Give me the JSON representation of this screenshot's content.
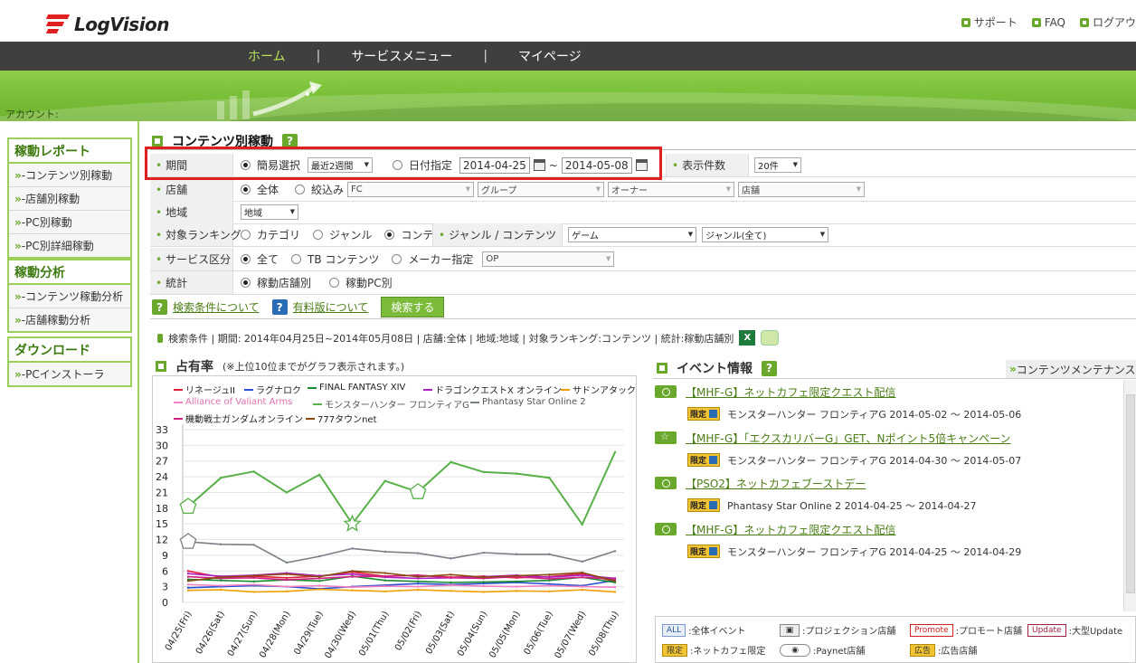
{
  "header": {
    "logo_text": "LogVision",
    "links": [
      {
        "label": "サポート",
        "icon": "home-icon"
      },
      {
        "label": "FAQ",
        "icon": "home-icon"
      },
      {
        "label": "ログアウ",
        "icon": "home-icon"
      }
    ]
  },
  "nav": {
    "items": [
      "ホーム",
      "サービスメニュー",
      "マイページ"
    ],
    "separator": "|",
    "active_index": 0
  },
  "account": {
    "label": "アカウント:"
  },
  "sidebar": {
    "groups": [
      {
        "title": "稼動レポート",
        "items": [
          "-コンテンツ別稼動",
          "-店舗別稼動",
          "-PC別稼動",
          "-PC別詳細稼動"
        ]
      },
      {
        "title": "稼動分析",
        "items": [
          "-コンテンツ稼動分析",
          "-店舗稼動分析"
        ]
      },
      {
        "title": "ダウンロード",
        "items": [
          "-PCインストーラ"
        ]
      }
    ],
    "bullet": "»"
  },
  "content": {
    "title": "コンテンツ別稼動",
    "help": "?"
  },
  "filters": {
    "period": {
      "label": "期間",
      "simple_label": "簡易選択",
      "simple_value": "最近2週間",
      "date_label": "日付指定",
      "date_from": "2014-04-25",
      "tilde": "~",
      "date_to": "2014-05-08",
      "display_count_label": "表示件数",
      "display_count_value": "20件"
    },
    "store": {
      "label": "店舗",
      "all_label": "全体",
      "narrow_label": "絞込み",
      "selects": [
        "FC",
        "グループ",
        "オーナー",
        "店舗"
      ]
    },
    "region": {
      "label": "地域",
      "value": "地域"
    },
    "ranking": {
      "label": "対象ランキング",
      "options": [
        "カテゴリ",
        "ジャンル",
        "コンテンツ"
      ],
      "genre_label": "ジャンル / コンテンツ",
      "genre_value": "ゲーム",
      "genre_all": "ジャンル(全て)"
    },
    "service": {
      "label": "サービス区分",
      "options": [
        "全て",
        "TB コンテンツ",
        "メーカー指定"
      ],
      "maker_value": "OP"
    },
    "stats": {
      "label": "統計",
      "options": [
        "稼動店舗別",
        "稼動PC別"
      ]
    }
  },
  "search": {
    "about_conditions": "検索条件について",
    "about_paid": "有料版について",
    "button": "検索する"
  },
  "condition_summary": "検索条件 | 期間: 2014年04月25日~2014年05月08日 | 店舗:全体 | 地域:地域 | 対象ランキング:コンテンツ | 統計:稼動店舗別",
  "share": {
    "title": "占有率",
    "note": "(※上位10位までがグラフ表示されます。)"
  },
  "chart_data": {
    "type": "line",
    "title": "占有率",
    "x": [
      "04/25(Fri)",
      "04/26(Sat)",
      "04/27(Sun)",
      "04/28(Mon)",
      "04/29(Tue)",
      "04/30(Wed)",
      "05/01(Thu)",
      "05/02(Fri)",
      "05/03(Sat)",
      "05/04(Sun)",
      "05/05(Mon)",
      "05/06(Tue)",
      "05/07(Wed)",
      "05/08(Thu)"
    ],
    "yticks": [
      0,
      3,
      6,
      9,
      12,
      15,
      18,
      21,
      24,
      27,
      30,
      33
    ],
    "ylim": [
      0,
      33
    ],
    "grid": true,
    "legend_placement": "top",
    "series": [
      {
        "name": "リネージュII",
        "color": "#e0203a",
        "values": [
          6.0,
          4.8,
          5.0,
          4.7,
          5.0,
          5.8,
          5.0,
          5.2,
          4.8,
          5.0,
          4.7,
          4.9,
          5.5,
          4.0
        ]
      },
      {
        "name": "ラグナロク",
        "color": "#2850d0",
        "values": [
          2.8,
          3.0,
          3.2,
          3.0,
          2.6,
          3.0,
          3.3,
          3.6,
          3.4,
          3.6,
          3.8,
          3.5,
          3.2,
          4.2
        ]
      },
      {
        "name": "FINAL FANTASY XIV",
        "color": "#1a8a30",
        "values": [
          4.4,
          4.2,
          4.0,
          4.3,
          4.1,
          5.0,
          4.2,
          4.0,
          3.8,
          3.9,
          4.0,
          4.2,
          4.8,
          3.8
        ]
      },
      {
        "name": "ドラゴンクエストX オンライン",
        "color": "#b020c0",
        "values": [
          5.5,
          5.0,
          5.2,
          5.6,
          5.1,
          5.4,
          4.8,
          4.6,
          4.7,
          4.9,
          5.2,
          4.8,
          5.2,
          4.6
        ]
      },
      {
        "name": "サドンアタック",
        "color": "#f0a000",
        "values": [
          2.3,
          2.4,
          2.0,
          2.1,
          2.5,
          2.3,
          2.1,
          2.4,
          2.2,
          2.0,
          2.2,
          2.1,
          2.4,
          2.0
        ]
      },
      {
        "name": "Alliance of Valiant Arms",
        "color": "#f080c0",
        "values": [
          3.4,
          3.2,
          3.4,
          3.0,
          3.2,
          2.9,
          3.1,
          3.0,
          3.3,
          3.1,
          3.0,
          3.2,
          3.0,
          2.9
        ]
      },
      {
        "name": "モンスターハンター フロンティアG",
        "color": "#58b048",
        "values": [
          18.3,
          23.8,
          25.0,
          21.0,
          24.4,
          15.0,
          23.2,
          21.1,
          26.8,
          24.9,
          24.6,
          23.8,
          14.9,
          28.7
        ]
      },
      {
        "name": "Phantasy Star Online 2",
        "color": "#7a8088",
        "values": [
          11.6,
          11.1,
          11.0,
          7.6,
          8.8,
          10.3,
          9.7,
          9.4,
          8.4,
          9.5,
          9.2,
          9.2,
          7.8,
          9.8
        ]
      },
      {
        "name": "機動戦士ガンダムオンライン",
        "color": "#d02080",
        "values": [
          4.9,
          4.6,
          4.7,
          4.3,
          4.6,
          4.9,
          5.0,
          5.2,
          4.7,
          4.6,
          4.9,
          4.5,
          4.8,
          4.4
        ]
      },
      {
        "name": "777タウンnet",
        "color": "#8a4a10",
        "values": [
          4.1,
          4.8,
          5.1,
          5.4,
          4.9,
          6.0,
          5.6,
          4.9,
          5.3,
          4.8,
          5.1,
          5.3,
          5.7,
          4.1
        ]
      }
    ]
  },
  "events": {
    "title": "イベント情報",
    "maintenance_link": "コンテンツメンテナンス一覧",
    "items": [
      {
        "title": "【MHF-G】ネットカフェ限定クエスト配信",
        "tag": "限定",
        "desc": "モンスターハンター フロンティアG  2014-05-02 ～ 2014-05-06",
        "badge": "circle-icon"
      },
      {
        "title": "【MHF-G】「エクスカリバーG」GET、Nポイント5倍キャンペーン",
        "tag": "限定",
        "desc": "モンスターハンター フロンティアG  2014-04-30 ～ 2014-05-07",
        "badge": "star-icon"
      },
      {
        "title": "【PSO2】ネットカフェブーストデー",
        "tag": "限定",
        "desc": "Phantasy Star Online 2  2014-04-25 ～ 2014-04-27",
        "badge": "circle-icon"
      },
      {
        "title": "【MHF-G】ネットカフェ限定クエスト配信",
        "tag": "限定",
        "desc": "モンスターハンター フロンティアG  2014-04-25 ～ 2014-04-29",
        "badge": "circle-icon"
      }
    ]
  },
  "event_legend": [
    {
      "tag": "ALL",
      "label": ":全体イベント"
    },
    {
      "tag": "",
      "label": ":プロジェクション店舗"
    },
    {
      "tag": "Promote",
      "label": ":プロモート店舗"
    },
    {
      "tag": "Update",
      "label": ":大型Update"
    },
    {
      "tag": "限定",
      "label": ":ネットカフェ限定"
    },
    {
      "tag": "",
      "label": ":Paynet店舗"
    },
    {
      "tag": "広告",
      "label": ":広告店舗"
    }
  ]
}
